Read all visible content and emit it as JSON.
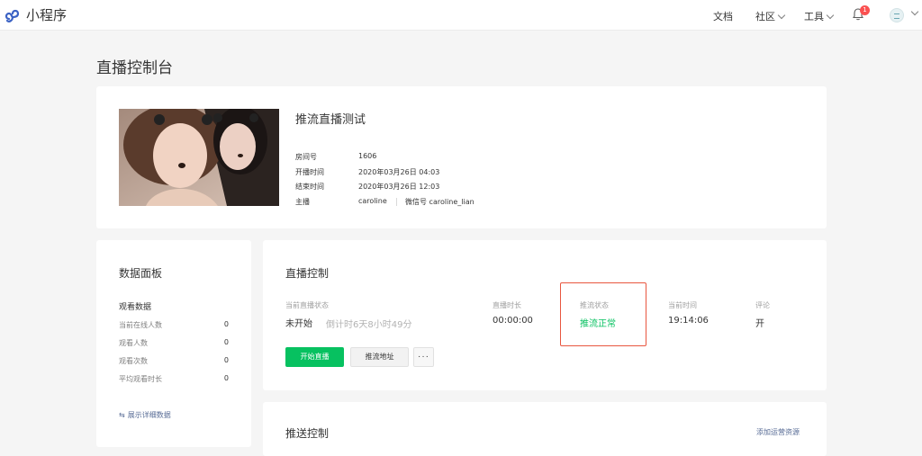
{
  "app": {
    "logo_text": "小程序"
  },
  "nav": {
    "docs": "文档",
    "community": "社区",
    "tools": "工具",
    "notification_count": "1"
  },
  "page": {
    "title": "直播控制台"
  },
  "room": {
    "title": "推流直播测试",
    "fields": [
      {
        "label": "房间号",
        "value": "1606"
      },
      {
        "label": "开播时间",
        "value": "2020年03月26日 04:03"
      },
      {
        "label": "结束时间",
        "value": "2020年03月26日 12:03"
      },
      {
        "label": "主播",
        "value": "caroline"
      }
    ],
    "wechat": "微信号 caroline_lian"
  },
  "panel": {
    "title": "数据面板",
    "subtitle": "观看数据",
    "stats": [
      {
        "label": "当前在线人数",
        "value": "0"
      },
      {
        "label": "观看人数",
        "value": "0"
      },
      {
        "label": "观看次数",
        "value": "0"
      },
      {
        "label": "平均观看时长",
        "value": "0"
      }
    ],
    "detail_link": "展示详细数据"
  },
  "control": {
    "title": "直播控制",
    "status_label": "当前直播状态",
    "status_value": "未开始",
    "countdown": "倒计时6天8小时49分",
    "duration_label": "直播时长",
    "duration_value": "00:00:00",
    "push_label": "推流状态",
    "push_value": "推流正常",
    "time_label": "当前时间",
    "time_value": "19:14:06",
    "comment_label": "评论",
    "comment_value": "开",
    "start_button": "开始直播",
    "push_url_button": "推流地址",
    "more_button": "···"
  },
  "push": {
    "title": "推送控制",
    "link": "添加运营资源"
  },
  "colors": {
    "primary_green": "#07c160",
    "link_blue": "#576b95",
    "highlight_red": "#e8563f",
    "badge_red": "#fa5151"
  }
}
